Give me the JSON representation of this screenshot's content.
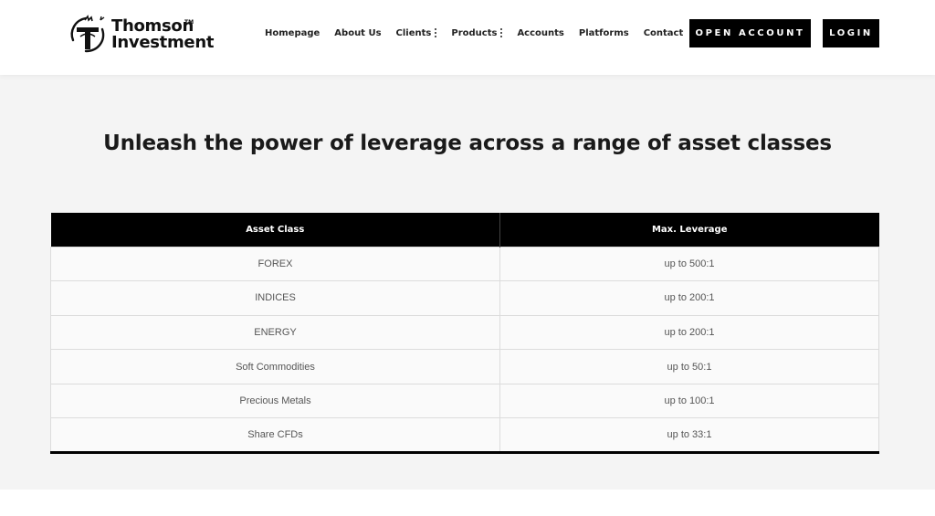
{
  "brand": {
    "line1": "Thomson",
    "line2": "Investment",
    "tm": "TM"
  },
  "nav": [
    {
      "label": "Homepage",
      "has_submenu": false
    },
    {
      "label": "About Us",
      "has_submenu": false
    },
    {
      "label": "Clients",
      "has_submenu": true
    },
    {
      "label": "Products",
      "has_submenu": true
    },
    {
      "label": "Accounts",
      "has_submenu": false
    },
    {
      "label": "Platforms",
      "has_submenu": false
    },
    {
      "label": "Contact",
      "has_submenu": false
    }
  ],
  "buttons": {
    "open_account": "OPEN ACCOUNT",
    "login": "LOGIN"
  },
  "main": {
    "headline": "Unleash the power of leverage across a range of asset classes"
  },
  "table": {
    "headers": [
      "Asset Class",
      "Max. Leverage"
    ],
    "rows": [
      [
        "FOREX",
        "up to 500:1"
      ],
      [
        "INDICES",
        "up to 200:1"
      ],
      [
        "ENERGY",
        "up to 200:1"
      ],
      [
        "Soft Commodities",
        "up to 50:1"
      ],
      [
        "Precious Metals",
        "up to 100:1"
      ],
      [
        "Share CFDs",
        "up to 33:1"
      ]
    ]
  },
  "icons": {
    "logo": "bull-t-logo-icon",
    "submenu": "vertical-dots-icon"
  },
  "colors": {
    "button_bg": "#000000",
    "page_bg": "#f4f4f4",
    "table_header_bg": "#000000"
  }
}
